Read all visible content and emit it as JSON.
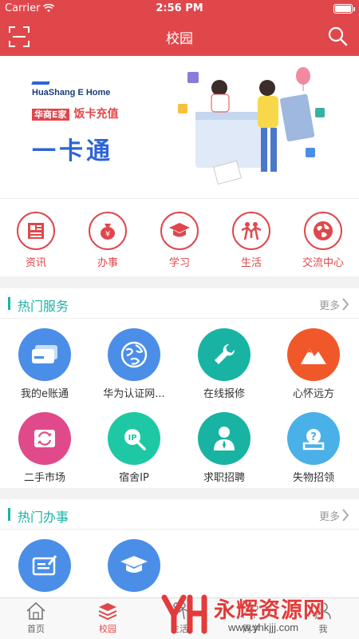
{
  "status_bar": {
    "carrier": "Carrier",
    "time": "2:56 PM",
    "battery_level": 1.0
  },
  "nav": {
    "title": "校园",
    "scan_icon": "scan-icon",
    "search_icon": "search-icon"
  },
  "banner": {
    "brand": "HuaShang E Home",
    "tag": "华商E家",
    "tagline": "饭卡充值",
    "card_word": "一卡通"
  },
  "categories": [
    {
      "label": "资讯",
      "icon": "news-icon"
    },
    {
      "label": "办事",
      "icon": "money-bag-icon"
    },
    {
      "label": "学习",
      "icon": "graduation-cap-icon"
    },
    {
      "label": "生活",
      "icon": "life-icon"
    },
    {
      "label": "交流中心",
      "icon": "globe-icon"
    }
  ],
  "hot_services": {
    "title": "热门服务",
    "more": "更多",
    "items": [
      {
        "label": "我的e账通",
        "icon": "card-icon",
        "color": "#4a8ee8"
      },
      {
        "label": "华为认证网...",
        "icon": "globe-icon",
        "color": "#4a8ee8"
      },
      {
        "label": "在线报修",
        "icon": "wrench-icon",
        "color": "#19b3a4"
      },
      {
        "label": "心怀远方",
        "icon": "mountain-icon",
        "color": "#f0582a"
      },
      {
        "label": "二手市场",
        "icon": "exchange-icon",
        "color": "#e04a8a"
      },
      {
        "label": "宿舍IP",
        "icon": "ip-search-icon",
        "color": "#1ec8a5"
      },
      {
        "label": "求职招聘",
        "icon": "person-icon",
        "color": "#19b3a4"
      },
      {
        "label": "失物招领",
        "icon": "question-box-icon",
        "color": "#4ab0e8"
      }
    ]
  },
  "hot_affairs": {
    "title": "热门办事",
    "more": "更多",
    "items": [
      {
        "label": "",
        "icon": "form-edit-icon",
        "color": "#4a8ee8"
      },
      {
        "label": "",
        "icon": "graduation-cap-icon",
        "color": "#4a8ee8"
      }
    ]
  },
  "tabbar": [
    {
      "label": "首页",
      "icon": "home-icon",
      "active": false
    },
    {
      "label": "校园",
      "icon": "layers-icon",
      "active": true
    },
    {
      "label": "生活",
      "icon": "life-icon",
      "active": false
    },
    {
      "label": "同学",
      "icon": "people-icon",
      "active": false
    },
    {
      "label": "我",
      "icon": "user-icon",
      "active": false
    }
  ],
  "watermark": {
    "name": "永辉资源网",
    "url": "www.yhkjjj.com"
  }
}
